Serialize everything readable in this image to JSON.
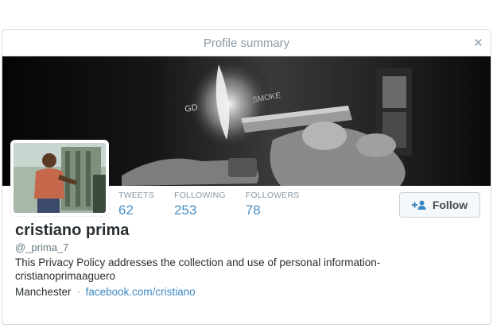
{
  "modal": {
    "title": "Profile summary",
    "close_label": "×"
  },
  "profile": {
    "name": "cristiano prima",
    "handle": "@_prima_7",
    "bio_line1": "This Privacy Policy addresses the collection and use of personal information-",
    "bio_line2": "cristianoprimaaguero",
    "location": "Manchester",
    "separator": "·",
    "website": "facebook.com/cristiano"
  },
  "stats": [
    {
      "label": "TWEETS",
      "value": "62"
    },
    {
      "label": "FOLLOWING",
      "value": "253"
    },
    {
      "label": "FOLLOWERS",
      "value": "78"
    }
  ],
  "follow_button": {
    "label": "Follow",
    "icon": "add-user-icon"
  },
  "colors": {
    "accent": "#3b88c3",
    "stat_value": "#4a8fc4",
    "muted": "#8899a6",
    "text": "#292f33"
  }
}
